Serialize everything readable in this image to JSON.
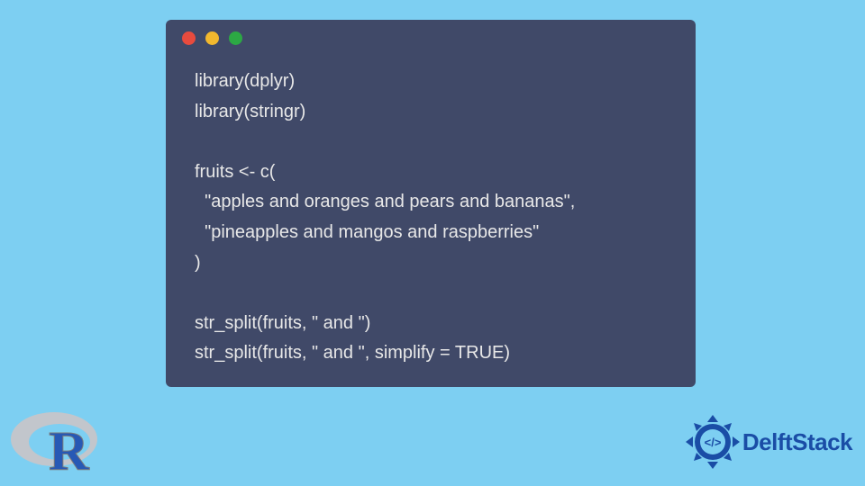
{
  "code": {
    "lines": [
      "library(dplyr)",
      "library(stringr)",
      "",
      "fruits <- c(",
      "  \"apples and oranges and pears and bananas\",",
      "  \"pineapples and mangos and raspberries\"",
      ")",
      "",
      "str_split(fruits, \" and \")",
      "str_split(fruits, \" and \", simplify = TRUE)"
    ]
  },
  "brand": {
    "name": "DelftStack"
  },
  "colors": {
    "background": "#7dcff2",
    "window": "#404968",
    "text": "#e8e8e8",
    "brand_blue": "#1a4da6"
  }
}
